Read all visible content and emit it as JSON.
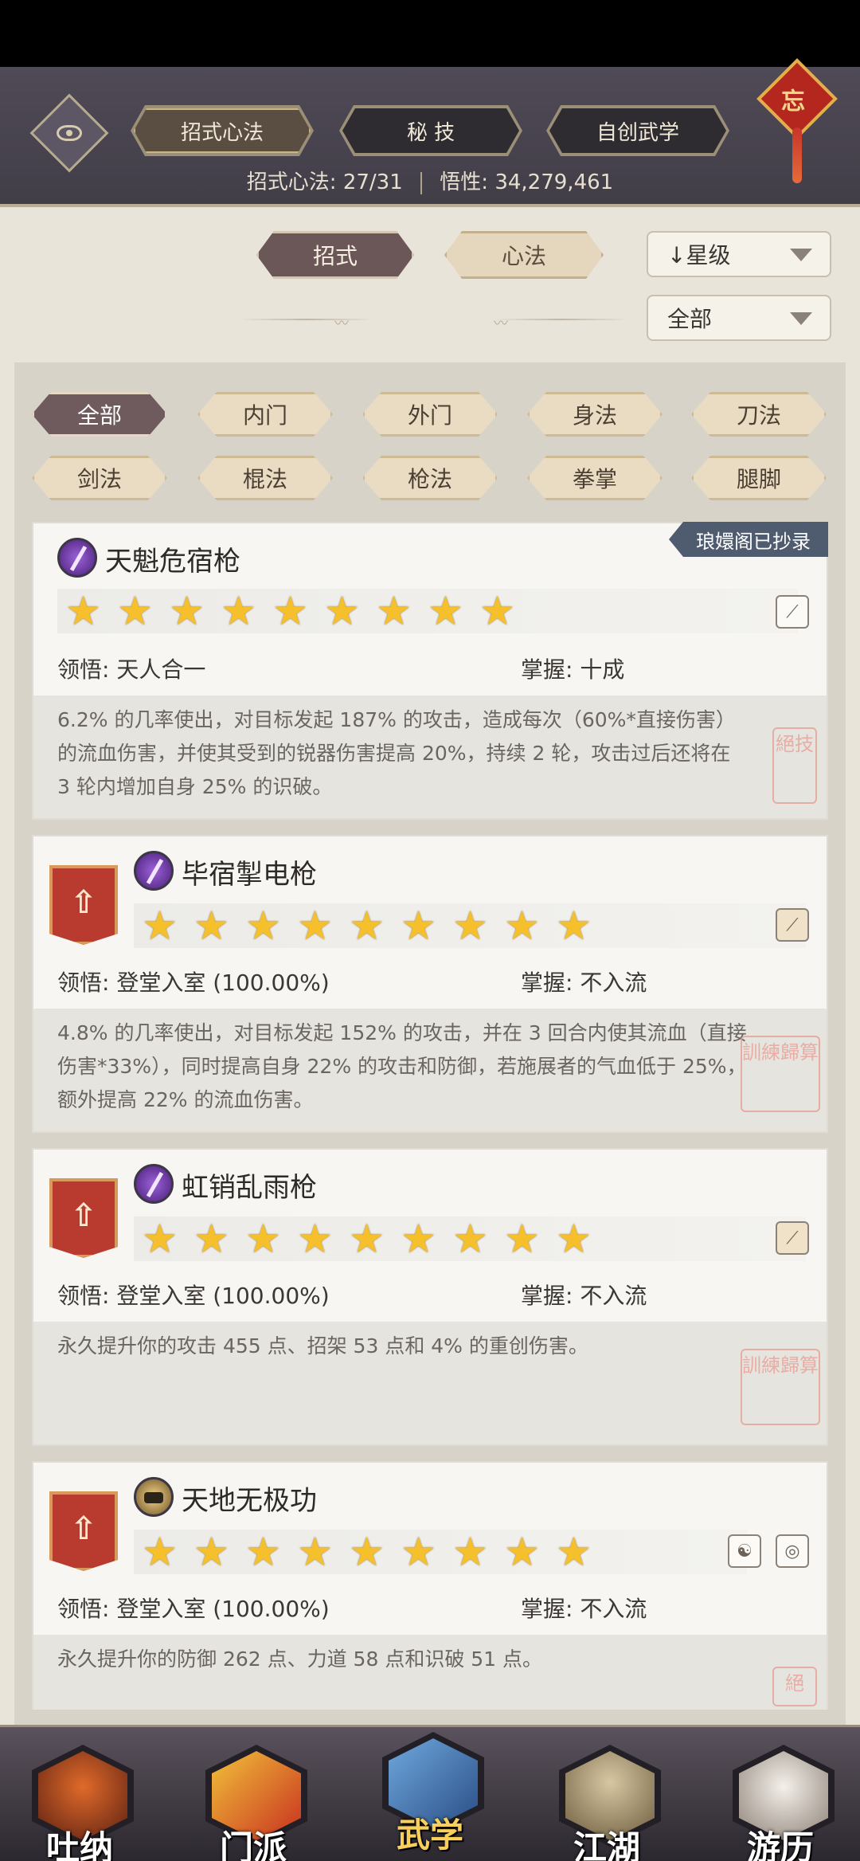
{
  "header": {
    "tabs": [
      "招式心法",
      "秘 技",
      "自创武学"
    ],
    "knot_char": "忘",
    "summary_label": "招式心法:",
    "summary_count": "27/31",
    "insight_label": "悟性:",
    "insight_value": "34,279,461"
  },
  "toggles": {
    "moves": "招式",
    "methods": "心法"
  },
  "sort_select": "↓星级",
  "scope_select": "全部",
  "filters": [
    "全部",
    "内门",
    "外门",
    "身法",
    "刀法",
    "剑法",
    "棍法",
    "枪法",
    "拳掌",
    "腿脚"
  ],
  "cards": [
    {
      "name": "天魁危宿枪",
      "stars": 9,
      "tag": "琅嬛阁已抄录",
      "insight_label": "领悟:",
      "insight_value": "天人合一",
      "mastery_label": "掌握:",
      "mastery_value": "十成",
      "description": "6.2% 的几率使出，对目标发起 187% 的攻击，造成每次（60%*直接伤害）的流血伤害，并使其受到的锐器伤害提高 20%，持续 2 轮，攻击过后还将在 3 轮内增加自身 25% 的识破。",
      "seal": "絕技"
    },
    {
      "name": "毕宿掣电枪",
      "stars": 9,
      "insight_label": "领悟:",
      "insight_value": "登堂入室 (100.00%)",
      "mastery_label": "掌握:",
      "mastery_value": "不入流",
      "description": "4.8% 的几率使出，对目标发起 152% 的攻击，并在 3 回合内使其流血（直接伤害*33%），同时提高自身 22% 的攻击和防御，若施展者的气血低于 25%，额外提高 22% 的流血伤害。",
      "seal": "訓練歸算"
    },
    {
      "name": "虹销乱雨枪",
      "stars": 9,
      "insight_label": "领悟:",
      "insight_value": "登堂入室 (100.00%)",
      "mastery_label": "掌握:",
      "mastery_value": "不入流",
      "description": "永久提升你的攻击 455 点、招架 53 点和 4% 的重创伤害。",
      "seal": "訓練歸算"
    },
    {
      "name": "天地无极功",
      "stars": 9,
      "insight_label": "领悟:",
      "insight_value": "登堂入室 (100.00%)",
      "mastery_label": "掌握:",
      "mastery_value": "不入流",
      "description": "永久提升你的防御 262 点、力道 58 点和识破 51 点。",
      "seal": "絕"
    }
  ],
  "nav": [
    "吐纳",
    "门派",
    "武学",
    "江湖",
    "游历"
  ],
  "colors": {
    "accent_gold": "#f5c02b",
    "tag_blue": "#4f5b6f",
    "banner_red": "#b93a2e"
  }
}
